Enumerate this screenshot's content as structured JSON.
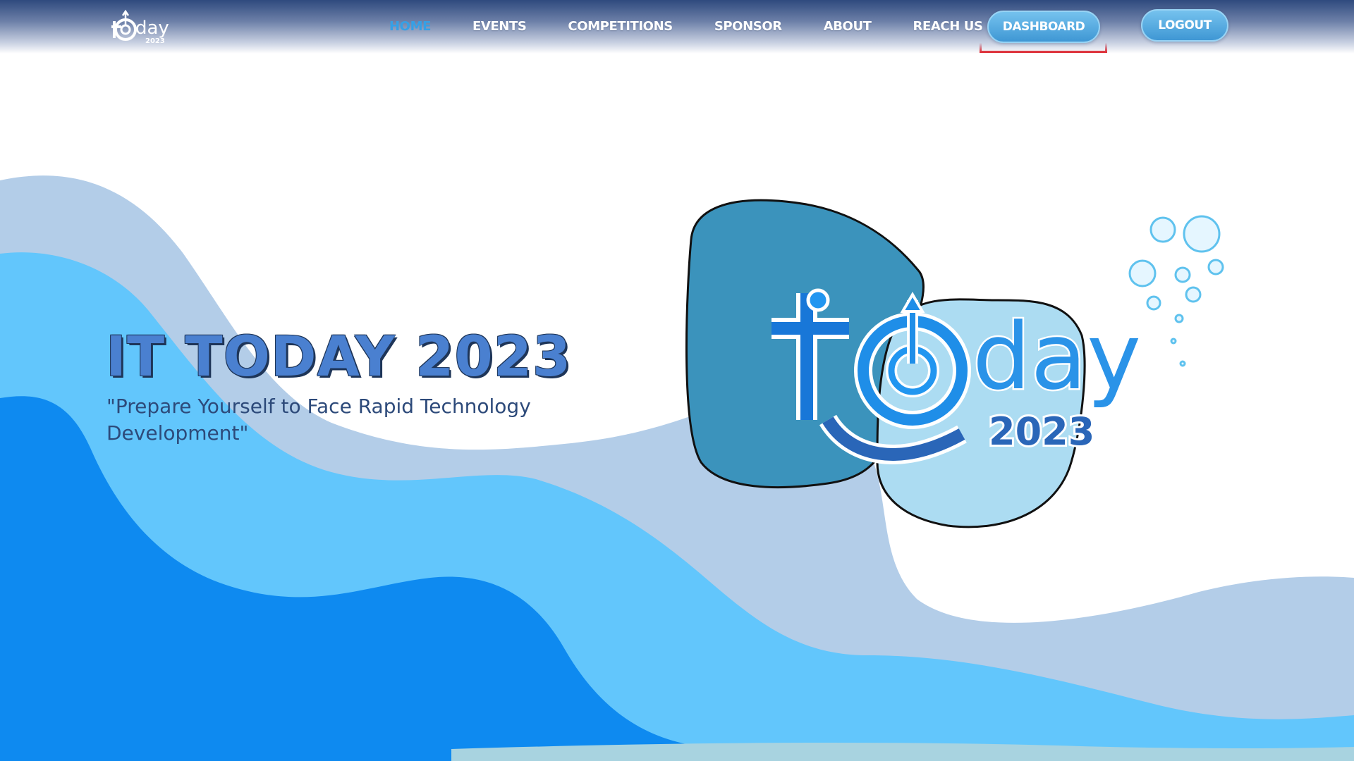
{
  "header": {
    "brand_logo_alt": "IT Today 2023",
    "nav": [
      {
        "label": "HOME",
        "active": true
      },
      {
        "label": "EVENTS",
        "active": false
      },
      {
        "label": "COMPETITIONS",
        "active": false
      },
      {
        "label": "SPONSOR",
        "active": false
      },
      {
        "label": "ABOUT",
        "active": false
      },
      {
        "label": "REACH US",
        "active": false
      }
    ],
    "dashboard_label": "DASHBOARD",
    "logout_label": "LOGOUT"
  },
  "hero": {
    "title": "IT TODAY 2023",
    "tagline": "\"Prepare Yourself to Face Rapid Technology Development\"",
    "logo_text": "day",
    "logo_year": "2023"
  },
  "colors": {
    "accent": "#35a0e6",
    "title": "#4a80d0",
    "highlight": "#e0141c",
    "wave_light": "#b3cde8",
    "wave_mid": "#62c6fc",
    "wave_deep": "#0e8af0"
  }
}
